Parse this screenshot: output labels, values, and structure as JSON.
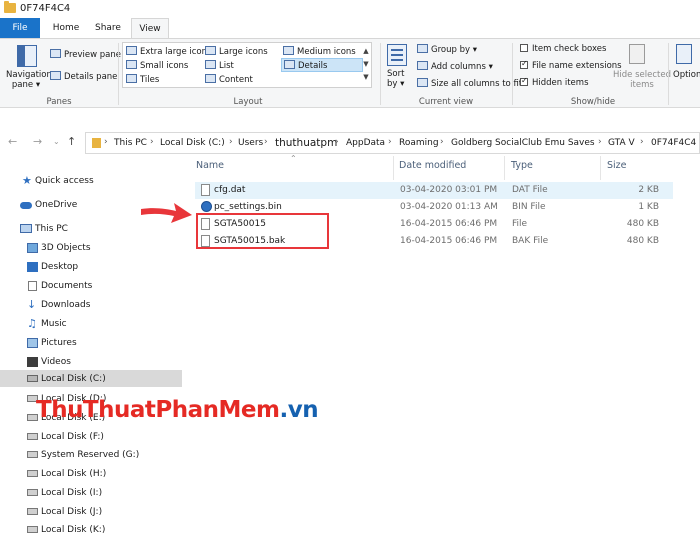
{
  "window": {
    "title": "0F74F4C4"
  },
  "ribbon_tabs": {
    "file": "File",
    "home": "Home",
    "share": "Share",
    "view": "View"
  },
  "ribbon": {
    "panes": {
      "navigation_pane": "Navigation\npane ▾",
      "preview_pane": "Preview pane",
      "details_pane": "Details pane",
      "group_label": "Panes"
    },
    "layout": {
      "items": [
        {
          "label": "Extra large icons"
        },
        {
          "label": "Large icons"
        },
        {
          "label": "Medium icons"
        },
        {
          "label": "Small icons"
        },
        {
          "label": "List"
        },
        {
          "label": "Details"
        },
        {
          "label": "Tiles"
        },
        {
          "label": "Content"
        }
      ],
      "selected": "Details",
      "group_label": "Layout"
    },
    "current_view": {
      "sort_by": "Sort\nby ▾",
      "group_by": "Group by ▾",
      "add_columns": "Add columns ▾",
      "size_all_columns": "Size all columns to fit",
      "group_label": "Current view"
    },
    "show_hide": {
      "item_check_boxes": "Item check boxes",
      "file_name_extensions": "File name extensions",
      "hidden_items": "Hidden items",
      "hide_selected": "Hide selected\nitems",
      "options": "Options",
      "group_label": "Show/hide",
      "checks": {
        "item_check_boxes": false,
        "file_name_extensions": true,
        "hidden_items": true
      }
    }
  },
  "address": {
    "crumbs": [
      "This PC",
      "Local Disk (C:)",
      "Users",
      "thuthuatpm",
      "AppData",
      "Roaming",
      "Goldberg SocialClub Emu Saves",
      "GTA V",
      "0F74F4C4"
    ]
  },
  "navpane": {
    "items": [
      {
        "label": "Quick access",
        "icon": "star-icon"
      },
      {
        "label": "OneDrive",
        "icon": "cloud-icon"
      },
      {
        "label": "This PC",
        "icon": "computer-icon"
      },
      {
        "label": "3D Objects",
        "icon": "cube-icon"
      },
      {
        "label": "Desktop",
        "icon": "desktop-icon"
      },
      {
        "label": "Documents",
        "icon": "documents-icon"
      },
      {
        "label": "Downloads",
        "icon": "download-icon"
      },
      {
        "label": "Music",
        "icon": "music-icon"
      },
      {
        "label": "Pictures",
        "icon": "pictures-icon"
      },
      {
        "label": "Videos",
        "icon": "videos-icon"
      },
      {
        "label": "Local Disk (C:)",
        "icon": "drive-icon"
      },
      {
        "label": "Local Disk (D:)",
        "icon": "drive-icon"
      },
      {
        "label": "Local Disk (E:)",
        "icon": "drive-icon"
      },
      {
        "label": "Local Disk (F:)",
        "icon": "drive-icon"
      },
      {
        "label": "System Reserved (G:)",
        "icon": "drive-icon"
      },
      {
        "label": "Local Disk (H:)",
        "icon": "drive-icon"
      },
      {
        "label": "Local Disk (I:)",
        "icon": "drive-icon"
      },
      {
        "label": "Local Disk (J:)",
        "icon": "drive-icon"
      },
      {
        "label": "Local Disk (K:)",
        "icon": "drive-icon"
      }
    ],
    "selected": "Local Disk (C:)"
  },
  "files": {
    "columns": {
      "name": "Name",
      "date": "Date modified",
      "type": "Type",
      "size": "Size"
    },
    "rows": [
      {
        "name": "cfg.dat",
        "date": "03-04-2020 03:01 PM",
        "type": "DAT File",
        "size": "2 KB"
      },
      {
        "name": "pc_settings.bin",
        "date": "03-04-2020 01:13 AM",
        "type": "BIN File",
        "size": "1 KB"
      },
      {
        "name": "SGTA50015",
        "date": "16-04-2015 06:46 PM",
        "type": "File",
        "size": "480 KB"
      },
      {
        "name": "SGTA50015.bak",
        "date": "16-04-2015 06:46 PM",
        "type": "BAK File",
        "size": "480 KB"
      }
    ]
  },
  "watermark": {
    "part1": "ThuThuat",
    "part2": "PhanMem",
    "part3": ".vn"
  },
  "colors": {
    "accent": "#1a73c9",
    "highlight_box": "#e8363a",
    "watermark_red": "#e52a24",
    "watermark_blue": "#1561b0"
  }
}
